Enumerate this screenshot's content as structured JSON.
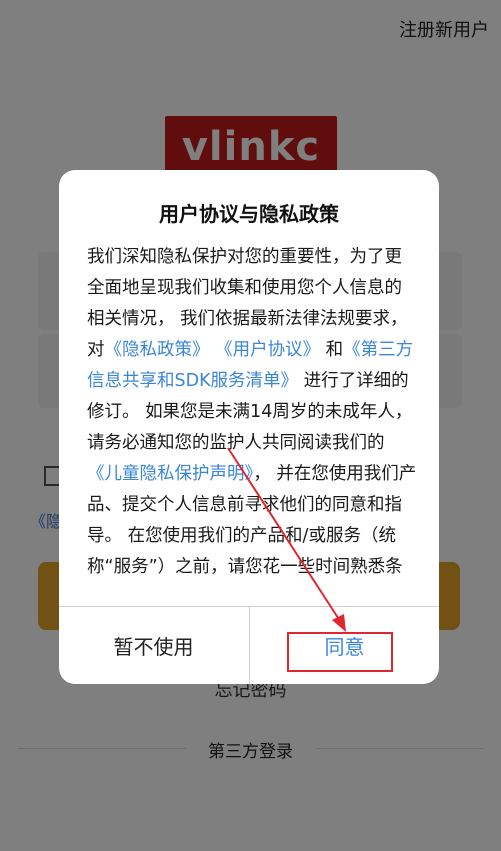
{
  "background": {
    "register_link": "注册新用户",
    "logo_text": "vlinkc",
    "policy_link_fragment": "《隐",
    "forgot_password": "忘记密码",
    "third_party_login": "第三方登录"
  },
  "dialog": {
    "title": "用户协议与隐私政策",
    "body": {
      "p1": "我们深知隐私保护对您的重要性，为了更全面地呈现我们收集和使用您个人信息的相关情况， 我们依据最新法律法规要求，对",
      "link_privacy": "《隐私政策》",
      "link_user_agreement": "《用户协议》",
      "and": "和",
      "link_sdk": "《第三方信息共享和SDK服务清单》",
      "p2": "进行了详细的修订。 如果您是未满14周岁的未成年人，请务必通知您的监护人共同阅读我们的",
      "link_children": "《儿童隐私保护声明》",
      "p3": "， 并在您使用我们产品、提交个人信息前寻求他们的同意和指导。 在您使用我们的产品和/或服务（统称“服务”）之前，请您花一些时间熟悉条款内容。 当您点击【同意】即表示您已充分阅读"
    },
    "cancel_label": "暂不使用",
    "agree_label": "同意"
  },
  "colors": {
    "link": "#3a86d9",
    "logo_bg": "#c41b1b",
    "login_button": "#e5a32a",
    "annotation": "#e0262e"
  }
}
